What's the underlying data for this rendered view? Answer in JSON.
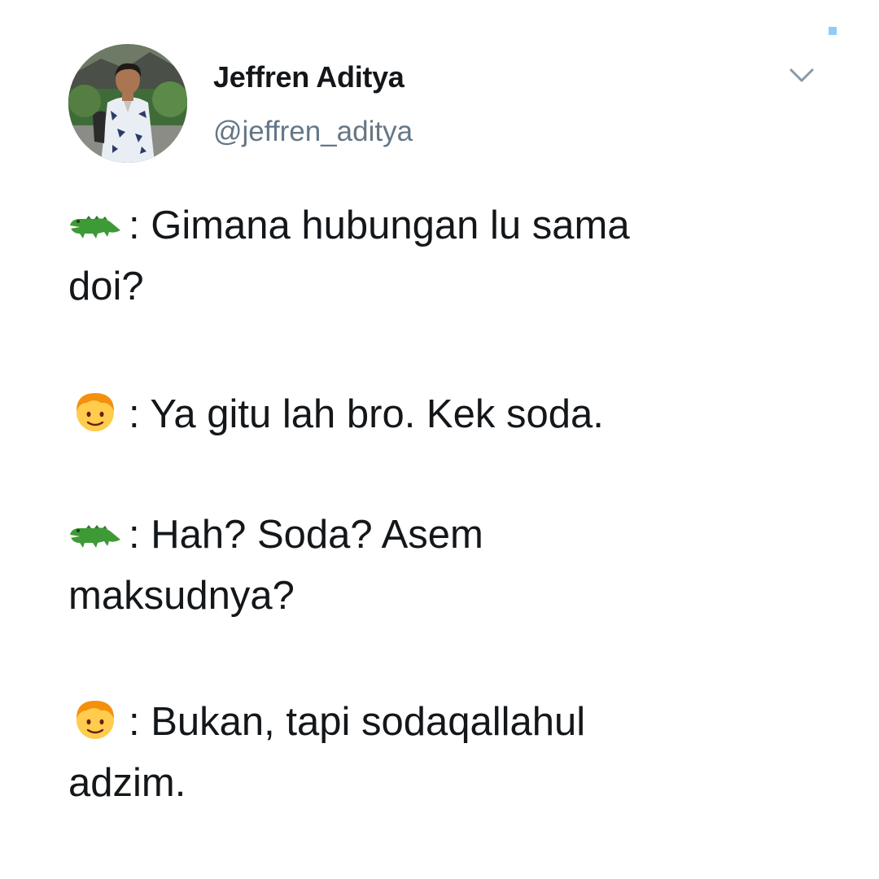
{
  "tweet": {
    "author": {
      "display_name": "Jeffren Aditya",
      "handle": "@jeffren_aditya",
      "avatar_icon": "profile-photo"
    },
    "menu_icon": "chevron-down-icon",
    "lines": [
      {
        "speaker_icon": "crocodile-emoji",
        "text": ": Gimana hubungan lu sama",
        "continuation": "doi?"
      },
      {
        "speaker_icon": "boy-emoji",
        "text": ": Ya gitu lah bro. Kek soda.",
        "continuation": ""
      },
      {
        "speaker_icon": "crocodile-emoji",
        "text": ": Hah? Soda? Asem",
        "continuation": "maksudnya?"
      },
      {
        "speaker_icon": "boy-emoji",
        "text": ": Bukan, tapi sodaqallahul",
        "continuation": "adzim."
      }
    ]
  },
  "colors": {
    "text": "#14171a",
    "secondary_text": "#657786",
    "accent_marker": "#8ecdf5",
    "crocodile": "#3e9a36",
    "boy_face": "#ffcc4d",
    "boy_hair": "#f4900c"
  }
}
